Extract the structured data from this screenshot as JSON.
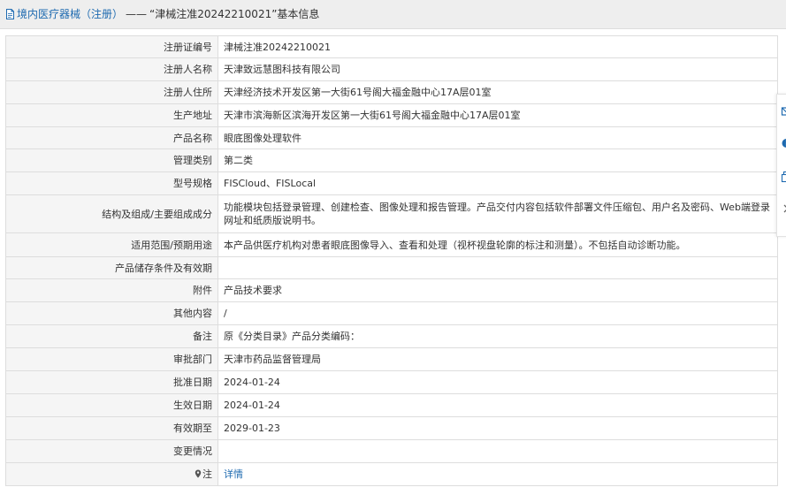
{
  "breadcrumb": {
    "category": "境内医疗器械（注册）",
    "separator": "——",
    "title": "“津械注准20242210021”基本信息"
  },
  "rows": [
    {
      "label": "注册证编号",
      "value": "津械注准20242210021"
    },
    {
      "label": "注册人名称",
      "value": "天津致远慧图科技有限公司"
    },
    {
      "label": "注册人住所",
      "value": "天津经济技术开发区第一大街61号阁大福金融中心17A层01室"
    },
    {
      "label": "生产地址",
      "value": "天津市滨海新区滨海开发区第一大街61号阁大福金融中心17A层01室"
    },
    {
      "label": "产品名称",
      "value": "眼底图像处理软件"
    },
    {
      "label": "管理类别",
      "value": "第二类"
    },
    {
      "label": "型号规格",
      "value": "FISCloud、FISLocal"
    },
    {
      "label": "结构及组成/主要组成成分",
      "value": "功能模块包括登录管理、创建检查、图像处理和报告管理。产品交付内容包括软件部署文件压缩包、用户名及密码、Web端登录网址和纸质版说明书。"
    },
    {
      "label": "适用范围/预期用途",
      "value": "本产品供医疗机构对患者眼底图像导入、查看和处理（视杯视盘轮廓的标注和测量）。不包括自动诊断功能。"
    },
    {
      "label": "产品储存条件及有效期",
      "value": ""
    },
    {
      "label": "附件",
      "value": "产品技术要求"
    },
    {
      "label": "其他内容",
      "value": "/"
    },
    {
      "label": "备注",
      "value": "原《分类目录》产品分类编码："
    },
    {
      "label": "审批部门",
      "value": "天津市药品监督管理局"
    },
    {
      "label": "批准日期",
      "value": "2024-01-24"
    },
    {
      "label": "生效日期",
      "value": "2024-01-24"
    },
    {
      "label": "有效期至",
      "value": "2029-01-23"
    },
    {
      "label": "变更情况",
      "value": ""
    }
  ],
  "note_row": {
    "label": "注",
    "link": "详情"
  },
  "colors": {
    "link": "#1e6ab0",
    "label_bg": "#f5f5f5",
    "border": "#dddddd",
    "header_bg": "#eeeeee",
    "side_icon": "#1e6ab0"
  },
  "icons": {
    "header": "document-icon",
    "note": "map-pin-icon",
    "side": [
      "mail-icon",
      "info-icon",
      "copy-icon",
      "chevron-right-icon"
    ]
  }
}
